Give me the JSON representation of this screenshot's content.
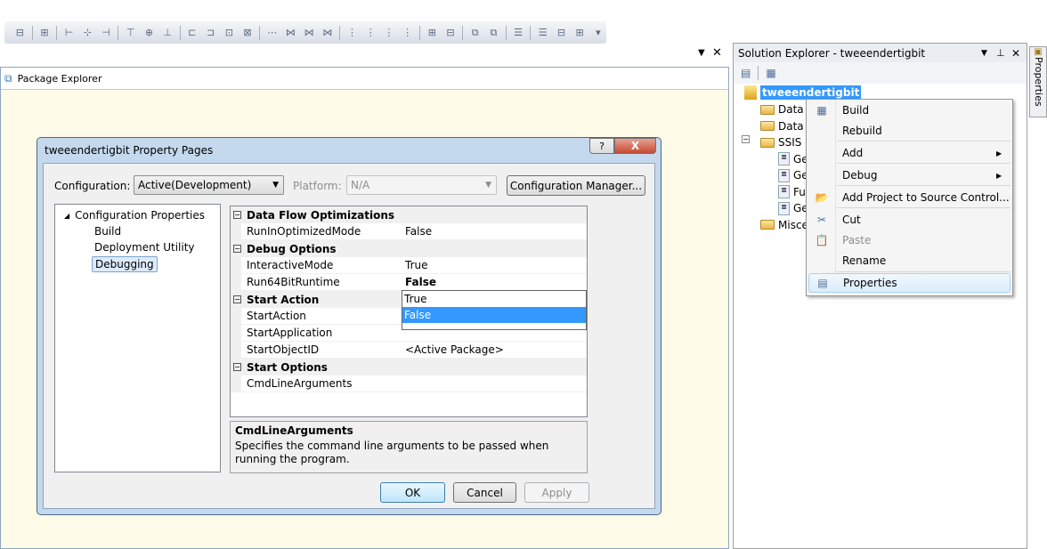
{
  "toolbar": {
    "icon_count": 28
  },
  "package_explorer": {
    "title": "Package Explorer",
    "pin_icon": "dropdown-arrow",
    "close_icon": "close-x",
    "bg_color": "#fefbe8"
  },
  "dialog": {
    "title": "tweeendertigbit Property Pages",
    "help_label": "?",
    "close_label": "X",
    "configuration_label": "Configuration:",
    "configuration_value": "Active(Development)",
    "platform_label": "Platform:",
    "platform_value": "N/A",
    "config_manager_label": "Configuration Manager...",
    "tree": {
      "root": "Configuration Properties",
      "items": [
        "Build",
        "Deployment Utility",
        "Debugging"
      ],
      "selected": "Debugging"
    },
    "grid": [
      {
        "type": "category",
        "name": "Data Flow Optimizations"
      },
      {
        "type": "prop",
        "name": "RunInOptimizedMode",
        "value": "False"
      },
      {
        "type": "category",
        "name": "Debug Options"
      },
      {
        "type": "prop",
        "name": "InteractiveMode",
        "value": "True"
      },
      {
        "type": "prop",
        "name": "Run64BitRuntime",
        "value": "False",
        "bold": true
      },
      {
        "type": "category",
        "name": "Start Action"
      },
      {
        "type": "prop",
        "name": "StartAction",
        "value": ""
      },
      {
        "type": "prop",
        "name": "StartApplication",
        "value": ""
      },
      {
        "type": "prop",
        "name": "StartObjectID",
        "value": "<Active Package>"
      },
      {
        "type": "category",
        "name": "Start Options"
      },
      {
        "type": "prop",
        "name": "CmdLineArguments",
        "value": ""
      }
    ],
    "dropdown_options": [
      "True",
      "False"
    ],
    "dropdown_selected": "False",
    "description": {
      "title": "CmdLineArguments",
      "text": "Specifies the command line arguments to be passed when running the program."
    },
    "ok_label": "OK",
    "cancel_label": "Cancel",
    "apply_label": "Apply"
  },
  "solution_explorer": {
    "title": "Solution Explorer - tweeendertigbit",
    "project": "tweeendertigbit",
    "items": [
      {
        "label": "Data S",
        "icon": "folder",
        "indent": 1
      },
      {
        "label": "Data S",
        "icon": "folder",
        "indent": 1
      },
      {
        "label": "SSIS P",
        "icon": "folder",
        "indent": 1
      },
      {
        "label": "Ge",
        "icon": "package",
        "indent": 2
      },
      {
        "label": "Ge",
        "icon": "package",
        "indent": 2
      },
      {
        "label": "Fu",
        "icon": "package",
        "indent": 2
      },
      {
        "label": "Ge",
        "icon": "package",
        "indent": 2
      },
      {
        "label": "Misce",
        "icon": "folder",
        "indent": 1
      }
    ]
  },
  "properties_tab": {
    "label": "Properties"
  },
  "context_menu": {
    "items": [
      {
        "label": "Build",
        "icon": "build-icon"
      },
      {
        "label": "Rebuild"
      },
      {
        "label": "Add",
        "submenu": true
      },
      {
        "label": "Debug",
        "submenu": true
      },
      {
        "label": "Add Project to Source Control...",
        "icon": "add-folder-icon"
      },
      {
        "label": "Cut",
        "icon": "scissors-icon"
      },
      {
        "label": "Paste",
        "icon": "paste-icon",
        "disabled": true
      },
      {
        "label": "Rename"
      },
      {
        "label": "Properties",
        "icon": "properties-icon",
        "highlighted": true
      }
    ]
  },
  "colors": {
    "selection": "#3399ff",
    "accent": "#c5d9ee"
  }
}
